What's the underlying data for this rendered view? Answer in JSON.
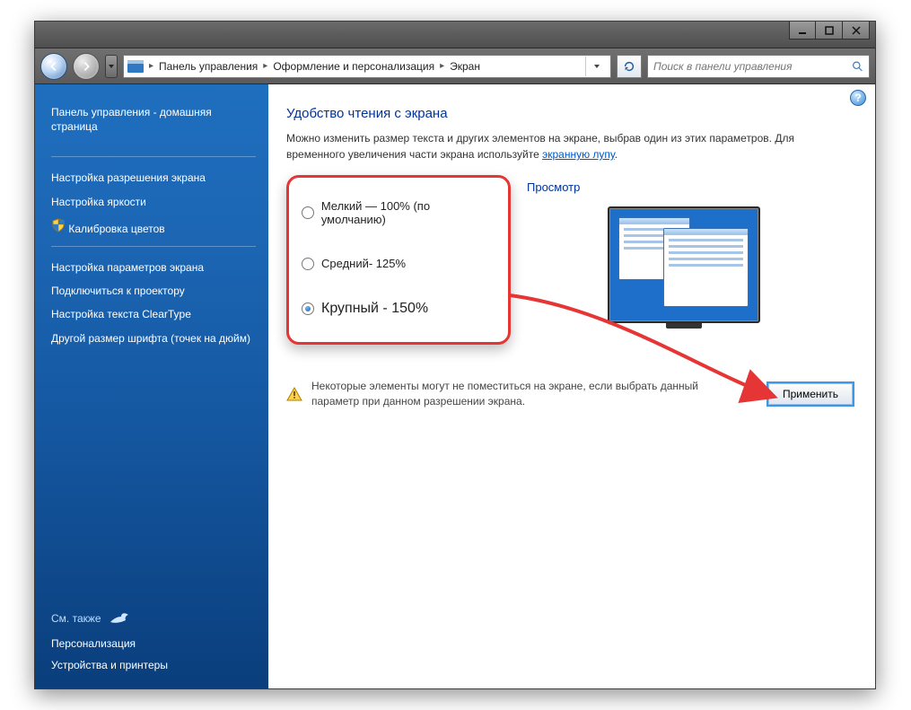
{
  "window": {
    "breadcrumbs": [
      "Панель управления",
      "Оформление и персонализация",
      "Экран"
    ]
  },
  "search": {
    "placeholder": "Поиск в панели управления"
  },
  "sidebar": {
    "home": "Панель управления - домашняя страница",
    "items": [
      "Настройка разрешения экрана",
      "Настройка яркости",
      "Калибровка цветов",
      "Настройка параметров экрана",
      "Подключиться к проектору",
      "Настройка текста ClearType",
      "Другой размер шрифта (точек на дюйм)"
    ],
    "see_also_label": "См. также",
    "see_also": [
      "Персонализация",
      "Устройства и принтеры"
    ]
  },
  "content": {
    "heading": "Удобство чтения с экрана",
    "lead_pre": "Можно изменить размер текста и других элементов на экране, выбрав один из этих параметров. Для временного увеличения части экрана используйте ",
    "lead_link": "экранную лупу",
    "lead_post": ".",
    "options": [
      {
        "label": "Мелкий — 100% (по умолчанию)",
        "selected": false
      },
      {
        "label": "Средний- 125%",
        "selected": false
      },
      {
        "label": "Крупный - 150%",
        "selected": true
      }
    ],
    "preview_label": "Просмотр",
    "warning": "Некоторые элементы могут не поместиться на экране, если выбрать данный параметр при данном разрешении экрана.",
    "apply": "Применить"
  }
}
